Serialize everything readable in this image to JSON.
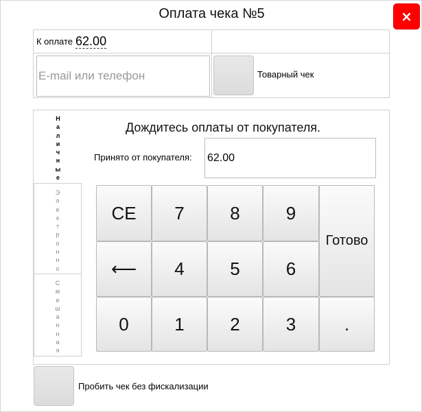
{
  "dialog": {
    "title": "Оплата чека №5",
    "close_label": "×"
  },
  "summary": {
    "amount_label": "К оплате",
    "amount_value": "62.00",
    "contact_placeholder": "E-mail или телефон",
    "contact_value": "",
    "receipt_label": "Товарный чек"
  },
  "payment_tabs": [
    {
      "label": "Наличные",
      "active": true
    },
    {
      "label": "Электронно",
      "active": false
    },
    {
      "label": "Смешанная",
      "active": false
    }
  ],
  "payment": {
    "wait_text": "Дождитесь оплаты от покупателя.",
    "received_label": "Принято от покупателя:",
    "received_value": "62.00"
  },
  "keypad": {
    "clear": "CE",
    "backspace": "⟵",
    "done": "Готово",
    "decimal": ".",
    "digits": [
      "0",
      "1",
      "2",
      "3",
      "4",
      "5",
      "6",
      "7",
      "8",
      "9"
    ]
  },
  "footer": {
    "nofiscal_label": "Пробить чек без фискализации"
  },
  "colors": {
    "close_bg": "#ff0000",
    "border": "#d0d0d0"
  }
}
